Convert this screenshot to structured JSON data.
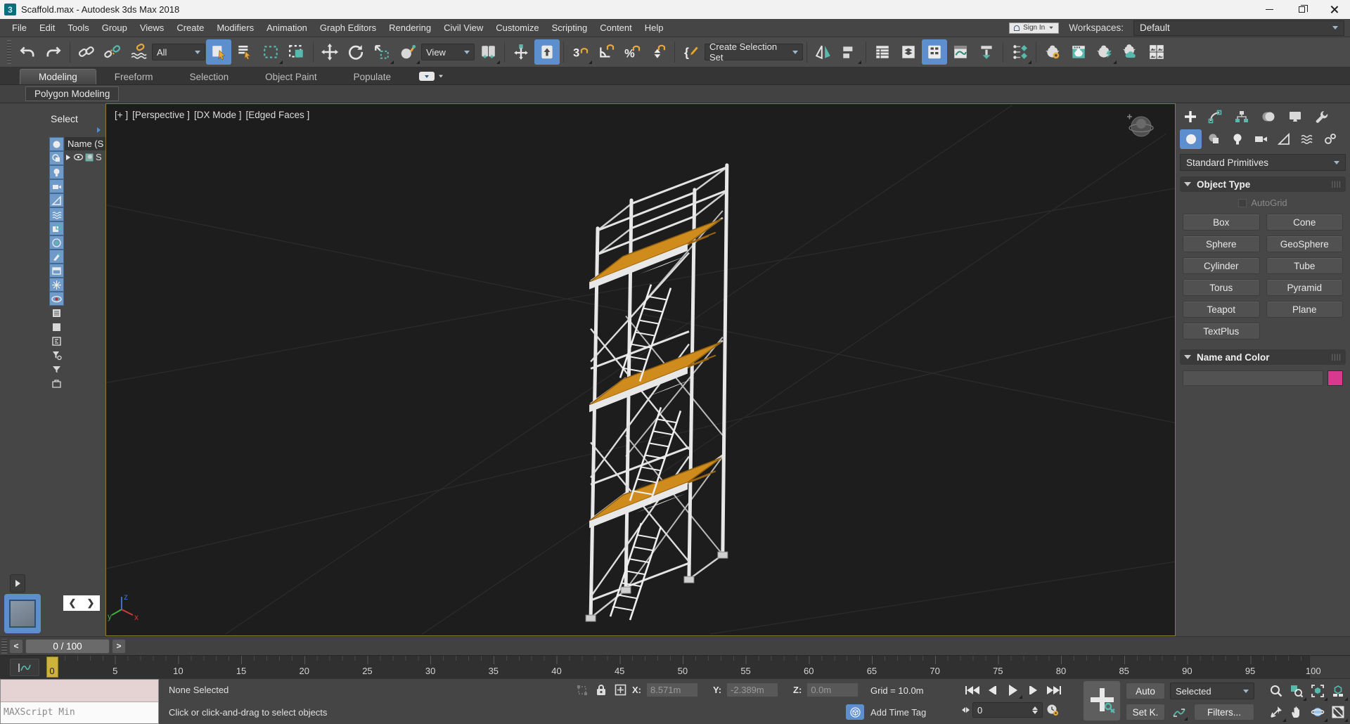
{
  "window": {
    "title": "Scaffold.max - Autodesk 3ds Max 2018",
    "app_badge": "3",
    "sign_in": "Sign In",
    "workspaces_label": "Workspaces:",
    "workspace_value": "Default"
  },
  "menubar": {
    "items": [
      "File",
      "Edit",
      "Tools",
      "Group",
      "Views",
      "Create",
      "Modifiers",
      "Animation",
      "Graph Editors",
      "Rendering",
      "Civil View",
      "Customize",
      "Scripting",
      "Content",
      "Help"
    ]
  },
  "toolbar": {
    "selection_filter": "All",
    "ref_coord": "View",
    "named_selection_set": "Create Selection Set",
    "snap_digit": "3",
    "percent_glyph": "%",
    "brace_glyph": "{"
  },
  "ribbon": {
    "tabs": [
      "Modeling",
      "Freeform",
      "Selection",
      "Object Paint",
      "Populate"
    ],
    "active_tab": "Modeling",
    "panel_tab": "Polygon Modeling"
  },
  "scene_explorer": {
    "title": "Select",
    "column_header": "Name (S",
    "row_text": "S"
  },
  "viewport": {
    "label_segments": [
      "[+ ]",
      "[Perspective ]",
      "[DX Mode ]",
      "[Edged Faces ]"
    ],
    "axis": {
      "x": "x",
      "y": "y",
      "z": "z"
    }
  },
  "command_panel": {
    "category_dropdown": "Standard Primitives",
    "object_type": {
      "title": "Object Type",
      "autogrid": "AutoGrid",
      "buttons": [
        "Box",
        "Cone",
        "Sphere",
        "GeoSphere",
        "Cylinder",
        "Tube",
        "Torus",
        "Pyramid",
        "Teapot",
        "Plane",
        "TextPlus"
      ]
    },
    "name_color": {
      "title": "Name and Color",
      "name_value": "",
      "swatch_color": "#d6398e"
    }
  },
  "time_slider": {
    "prev": "<",
    "value": "0 / 100",
    "next": ">"
  },
  "timeline": {
    "labels": [
      "0",
      "5",
      "10",
      "15",
      "20",
      "25",
      "30",
      "35",
      "40",
      "45",
      "50",
      "55",
      "60",
      "65",
      "70",
      "75",
      "80",
      "85",
      "90",
      "95",
      "100"
    ],
    "current_frame": "0"
  },
  "status": {
    "maxscript_listener": "MAXScript Min",
    "selection_status": "None Selected",
    "prompt": "Click or click-and-drag to select objects",
    "x_label": "X:",
    "x_value": "8.571m",
    "y_label": "Y:",
    "y_value": "-2.389m",
    "z_label": "Z:",
    "z_value": "0.0m",
    "grid_value": "Grid = 10.0m",
    "add_time_tag": "Add Time Tag",
    "frame_value": "0",
    "auto_key": "Auto",
    "set_key": "Set K.",
    "key_set_dropdown": "Selected",
    "filters": "Filters..."
  },
  "colors": {
    "highlight_blue": "#5d8fce",
    "object_color_swatch": "#d6398e",
    "frame_marker_yellow": "#cdb33c",
    "platform_orange": "#cf8c1d",
    "accent_teal": "#57b8ac",
    "accent_gold": "#e8a93c"
  }
}
